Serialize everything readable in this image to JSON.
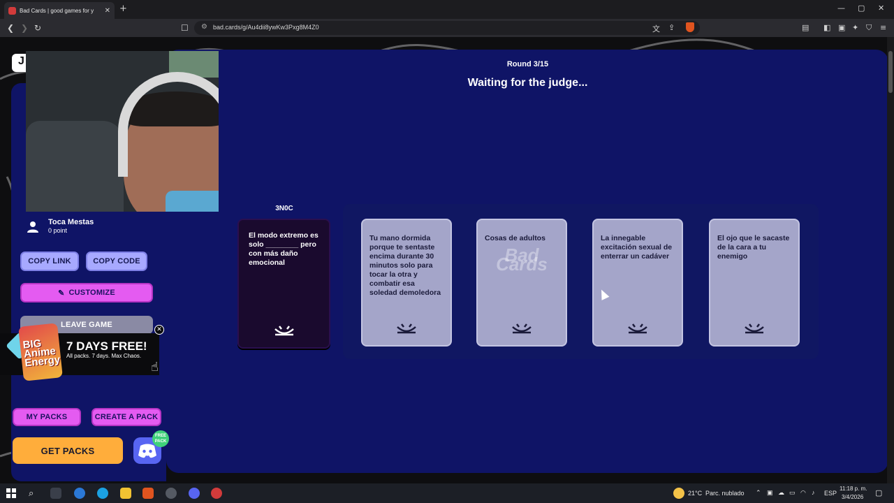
{
  "browser": {
    "tab_title": "Bad Cards | good games for y",
    "tab_close": "✕",
    "new_tab": "+",
    "url": "bad.cards/g/Au4dii8ywKw3Pxg8M4Z0",
    "window_controls": [
      "—",
      "▢",
      "✕"
    ]
  },
  "page": {
    "logo_letter": "J",
    "round_label": "Round 3/15",
    "status_text": "Waiting for the judge...",
    "player": {
      "name": "Toca Mestas",
      "points": "0 point"
    },
    "buttons": {
      "copy_link": "COPY LINK",
      "copy_code": "COPY CODE",
      "customize": "CUSTOMIZE",
      "leave_game": "LEAVE GAME",
      "my_packs": "MY PACKS",
      "create_pack": "CREATE A PACK",
      "get_packs": "GET PACKS"
    },
    "promo": {
      "art_text": "BIG Anime Energy",
      "title": "7 DAYS FREE!",
      "subtitle": "All packs. 7 days. Max Chaos.",
      "close": "✕"
    },
    "discord_badge": "FREE PACK",
    "judge_name": "3N0C",
    "black_card": "El modo extremo es solo ________ pero con más daño emocional",
    "white_cards": [
      {
        "text": "Tu mano dormida porque te sentaste encima durante 30 minutos solo para tocar la otra y combatir esa soledad demoledora"
      },
      {
        "text": "Cosas de adultos",
        "watermark": "Bad Cards"
      },
      {
        "text": "La innegable excitación sexual de enterrar un cadáver"
      },
      {
        "text": "El ojo que le sacaste de la cara a tu enemigo"
      }
    ]
  },
  "taskbar": {
    "weather": "21°C",
    "weather_desc": "Parc. nublado",
    "lang": "ESP",
    "time": "11:18 p. m.",
    "date": "3/4/2026"
  },
  "colors": {
    "panel": "#0f1466",
    "lavender": "#a7a9ff",
    "pink": "#e45bf1",
    "orange": "#ffad3b"
  }
}
